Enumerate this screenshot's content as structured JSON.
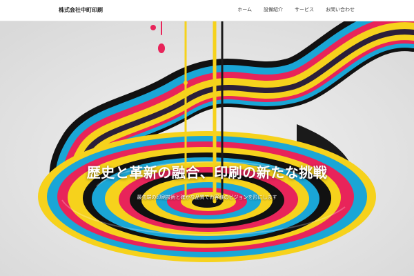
{
  "header": {
    "brand": "株式会社中町印刷",
    "nav": [
      "ホーム",
      "設備紹介",
      "サービス",
      "お問い合わせ"
    ]
  },
  "hero": {
    "title": "歴史と革新の融合、印刷の新たな挑戦",
    "subtitle": "最先端の印刷技術と確かな品質でお客様のビジョンを形にします"
  },
  "colors": {
    "cyan": "#1aa6d6",
    "magenta": "#e8245a",
    "yellow": "#f6d21c",
    "black": "#1a1a1a",
    "background": "#ececec"
  },
  "image": {
    "icon": "ink-swirl-image"
  }
}
